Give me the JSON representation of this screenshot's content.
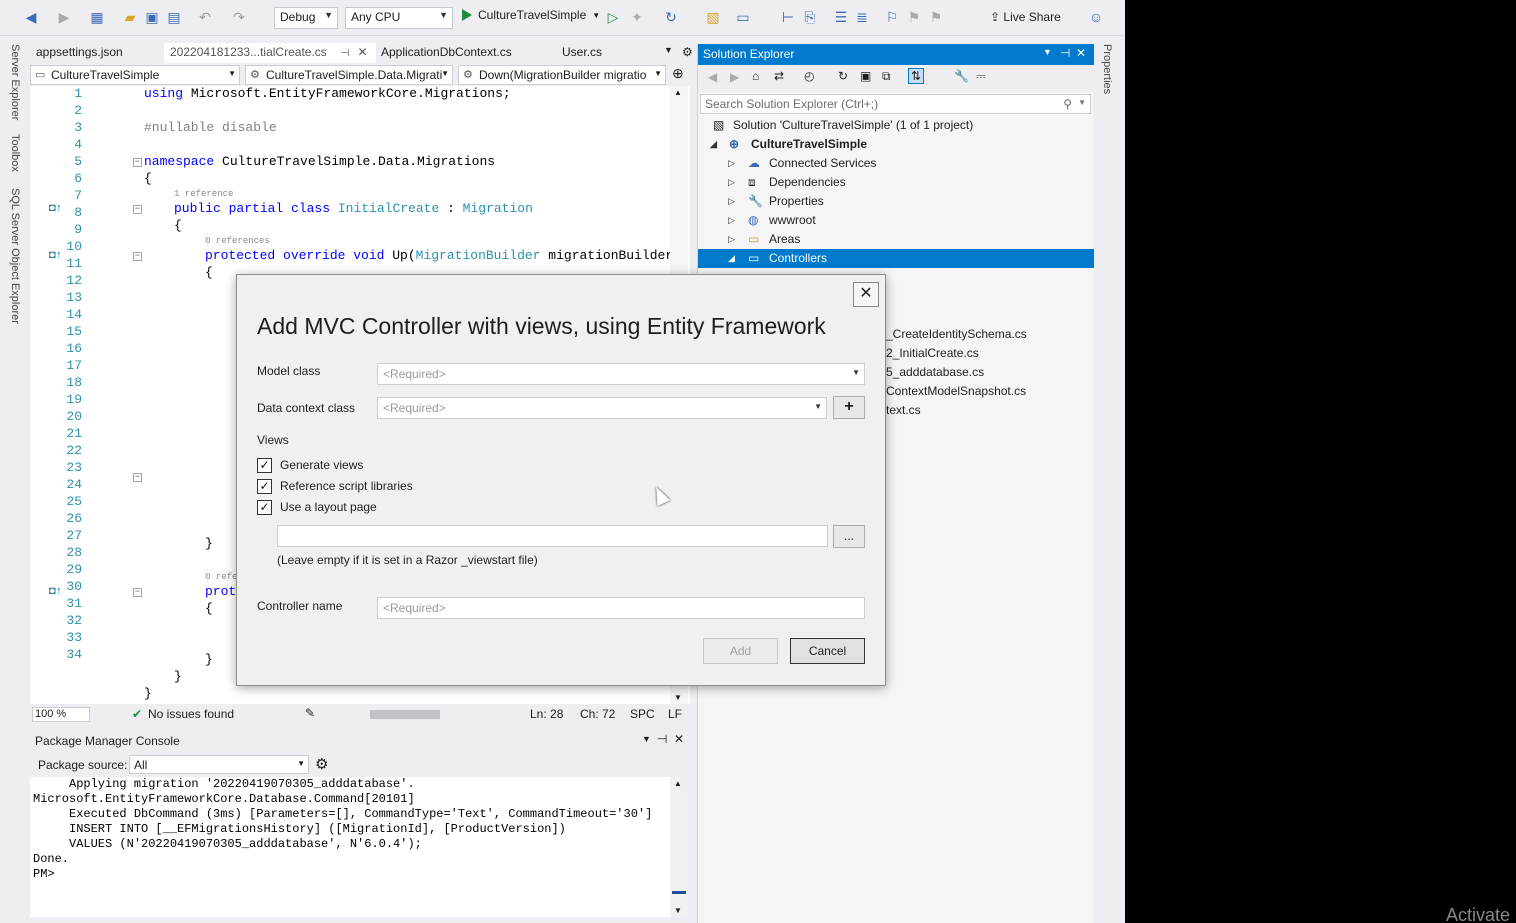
{
  "toolbar": {
    "config": "Debug",
    "platform": "Any CPU",
    "run_target": "CultureTravelSimple",
    "live_share": "Live Share"
  },
  "side_tabs": [
    "Server Explorer",
    "Toolbox",
    "SQL Server Object Explorer"
  ],
  "properties_tab": "Properties",
  "doc_tabs": [
    {
      "label": "appsettings.json"
    },
    {
      "label": "202204181233...tialCreate.cs"
    },
    {
      "label": "ApplicationDbContext.cs"
    },
    {
      "label": "User.cs"
    }
  ],
  "navbar": {
    "project": "CultureTravelSimple",
    "type": "CultureTravelSimple.Data.Migrati",
    "member": "Down(MigrationBuilder migratio"
  },
  "code": {
    "line_numbers": [
      "1",
      "2",
      "3",
      "4",
      "5",
      "6",
      "7",
      "8",
      "9",
      "10",
      "11",
      "12",
      "13",
      "14",
      "15",
      "16",
      "17",
      "18",
      "19",
      "20",
      "21",
      "22",
      "23",
      "24",
      "25",
      "26",
      "27",
      "28",
      "29",
      "30",
      "31",
      "32",
      "33",
      "34"
    ],
    "l1_kw": "using",
    "l1_rest": " Microsoft.EntityFrameworkCore.Migrations;",
    "l3": "#nullable disable",
    "l5_kw": "namespace",
    "l5_rest": " CultureTravelSimple.Data.Migrations",
    "brace_open": "{",
    "brace_close": "}",
    "ref_1": "1 reference",
    "l7_kw": "public partial class",
    "l7_type": "InitialCreate",
    "l7_colon": " : ",
    "l7_base": "Migration",
    "ref_0": "0 references",
    "l9_kw": "protected override void",
    "l9_name": " Up(",
    "l9_type": "MigrationBuilder",
    "l9_rest": " migrationBuilder)",
    "ref_0_trunc": "0 refere",
    "l28_kw": "prot"
  },
  "editor_status": {
    "zoom": "100 %",
    "issues": "No issues found",
    "line": "Ln: 28",
    "col": "Ch: 72",
    "spc": "SPC",
    "eol": "LF"
  },
  "pmc": {
    "title": "Package Manager Console",
    "source_label": "Package source:",
    "source_value": "All",
    "output": [
      "     Applying migration '20220419070305_adddatabase'.",
      "Microsoft.EntityFrameworkCore.Database.Command[20101]",
      "     Executed DbCommand (3ms) [Parameters=[], CommandType='Text', CommandTimeout='30']",
      "     INSERT INTO [__EFMigrationsHistory] ([MigrationId], [ProductVersion])",
      "     VALUES (N'20220419070305_adddatabase', N'6.0.4');",
      "Done.",
      "PM>"
    ]
  },
  "solution_explorer": {
    "title": "Solution Explorer",
    "search_placeholder": "Search Solution Explorer (Ctrl+;)",
    "solution": "Solution 'CultureTravelSimple' (1 of 1 project)",
    "project": "CultureTravelSimple",
    "items": [
      "Connected Services",
      "Dependencies",
      "Properties",
      "wwwroot",
      "Areas",
      "Controllers"
    ],
    "partial_files": [
      "_CreateIdentitySchema.cs",
      "2_InitialCreate.cs",
      "5_adddatabase.cs",
      "ContextModelSnapshot.cs",
      "text.cs"
    ]
  },
  "dialog": {
    "title": "Add MVC Controller with views, using Entity Framework",
    "close": "✕",
    "model_class_label": "Model class",
    "model_class_placeholder": "<Required>",
    "data_context_label": "Data context class",
    "data_context_placeholder": "<Required>",
    "plus": "+",
    "views_label": "Views",
    "generate_views": "Generate views",
    "reference_scripts": "Reference script libraries",
    "use_layout": "Use a layout page",
    "browse": "...",
    "layout_hint": "(Leave empty if it is set in a Razor _viewstart file)",
    "controller_name_label": "Controller name",
    "controller_name_placeholder": "<Required>",
    "add": "Add",
    "cancel": "Cancel",
    "checks": [
      true,
      true,
      true
    ]
  },
  "watermark": "Activate"
}
